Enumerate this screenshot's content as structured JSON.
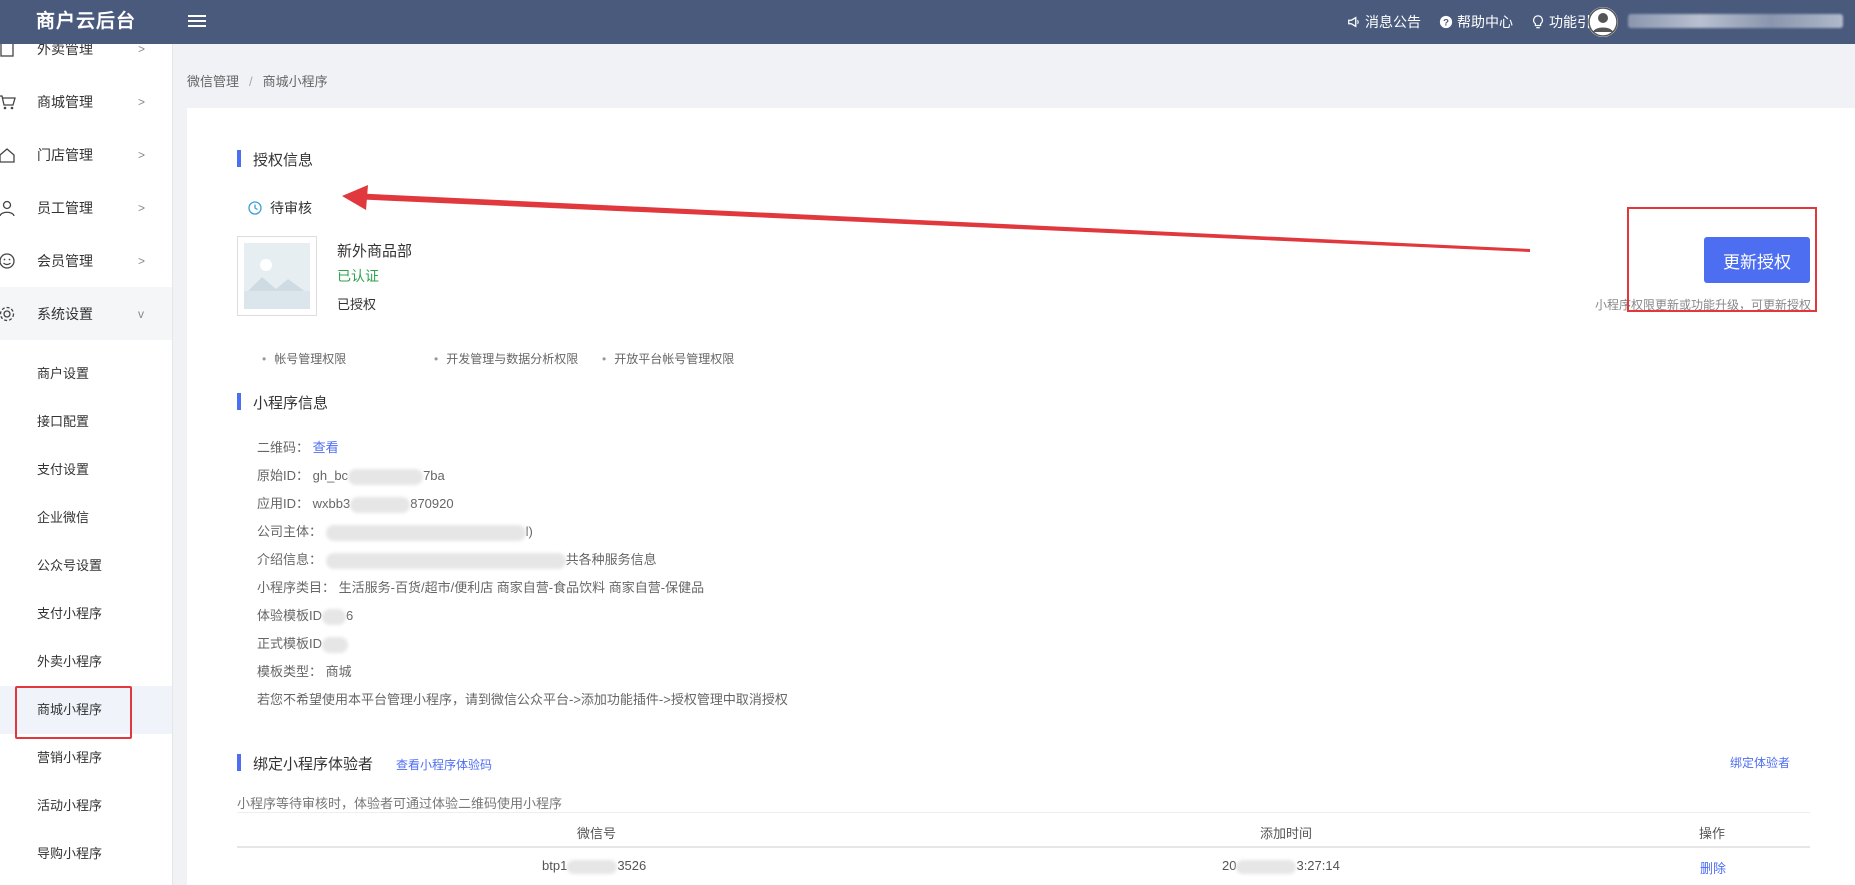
{
  "header": {
    "logo": "商户云后台",
    "nav": [
      {
        "icon": "megaphone-icon",
        "label": "消息公告"
      },
      {
        "icon": "help-circle-icon",
        "label": "帮助中心"
      },
      {
        "icon": "lightbulb-icon",
        "label": "功能引导"
      }
    ]
  },
  "sidebar": {
    "items": [
      {
        "label": "外卖管理",
        "icon": "file-icon"
      },
      {
        "label": "商城管理",
        "icon": "cart-icon"
      },
      {
        "label": "门店管理",
        "icon": "home-icon"
      },
      {
        "label": "员工管理",
        "icon": "user-icon"
      },
      {
        "label": "会员管理",
        "icon": "smile-icon"
      },
      {
        "label": "系统设置",
        "icon": "gear-icon"
      }
    ],
    "sub_items": [
      "商户设置",
      "接口配置",
      "支付设置",
      "企业微信",
      "公众号设置",
      "支付小程序",
      "外卖小程序",
      "商城小程序",
      "营销小程序",
      "活动小程序",
      "导购小程序"
    ],
    "active_sub": "商城小程序"
  },
  "breadcrumb": [
    "微信管理",
    "商城小程序"
  ],
  "auth": {
    "title": "授权信息",
    "status": "待审核",
    "app_name": "新外商品部",
    "verified": "已认证",
    "authorized": "已授权",
    "permissions": [
      "帐号管理权限",
      "开发管理与数据分析权限",
      "开放平台帐号管理权限"
    ],
    "update_button": "更新授权",
    "update_hint": "小程序权限更新或功能升级，可更新授权"
  },
  "miniapp": {
    "title": "小程序信息",
    "qrcode_label": "二维码：",
    "qrcode_link": "查看",
    "original_id_label": "原始ID：",
    "original_id_prefix": "gh_bc",
    "original_id_suffix": "7ba",
    "app_id_label": "应用ID：",
    "app_id_prefix": "wxbb3",
    "app_id_suffix": "870920",
    "company_label": "公司主体：",
    "company_suffix": "l)",
    "intro_label": "介绍信息：",
    "intro_suffix": "共各种服务信息",
    "category_label": "小程序类目：",
    "category_value": "生活服务-百货/超市/便利店 商家自营-食品饮料 商家自营-保健品",
    "trial_template_label": "体验模板ID",
    "trial_template_suffix": "6",
    "formal_template_label": "正式模板ID",
    "template_type_label": "模板类型：",
    "template_type_value": "商城",
    "cancel_note": "若您不希望使用本平台管理小程序，请到微信公众平台->添加功能插件->授权管理中取消授权"
  },
  "testers": {
    "title": "绑定小程序体验者",
    "view_code_link": "查看小程序体验码",
    "bind_link": "绑定体验者",
    "note": "小程序等待审核时，体验者可通过体验二维码使用小程序",
    "columns": [
      "微信号",
      "添加时间",
      "操作"
    ],
    "rows": [
      {
        "wechat_prefix": "btp1",
        "wechat_suffix": "3526",
        "time_prefix": "20",
        "time_suffix": "3:27:14",
        "action": "删除"
      }
    ]
  },
  "colors": {
    "topbar": "#4a5a7d",
    "accent": "#4e6ef2",
    "verified": "#2ea44f",
    "annotation": "#e0383c"
  }
}
